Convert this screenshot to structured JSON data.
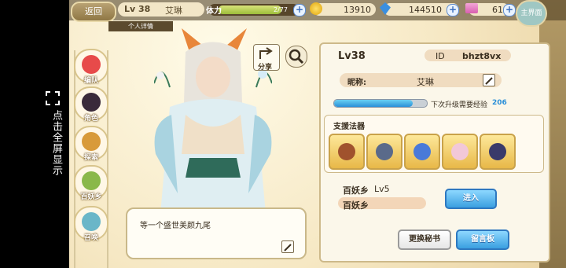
{
  "overlay": {
    "fullscreen_text": "点击全屏显示",
    "fullscreen_icon": "expand-icon"
  },
  "topbar": {
    "back_label": "返回",
    "level": "Lv 38",
    "player_name": "艾琳",
    "stamina_label": "体力",
    "stamina_value": "2/77",
    "gold": "13910",
    "gems": "144510",
    "tickets": "61",
    "main_label": "主界面",
    "tab_label": "个人详情"
  },
  "sidebar": {
    "items": [
      {
        "label": "编队",
        "icon": "team-icon"
      },
      {
        "label": "角色",
        "icon": "character-icon"
      },
      {
        "label": "探索",
        "icon": "explore-icon"
      },
      {
        "label": "百妖乡",
        "icon": "village-icon"
      },
      {
        "label": "召唤",
        "icon": "summon-icon"
      }
    ]
  },
  "stage": {
    "share_label": "分享",
    "quote": "等一个盛世美颜九尾"
  },
  "profile": {
    "level": "Lv38",
    "id_label": "ID",
    "id_value": "bhzt8vx",
    "nickname_label": "昵称:",
    "nickname_value": "艾琳",
    "xp_label": "下次升级需要经验",
    "xp_value": "206",
    "xp_progress": 0.85,
    "support_title": "支援法器",
    "support_items": [
      {
        "icon": "crossbow-icon"
      },
      {
        "icon": "spear-icon"
      },
      {
        "icon": "gem-cluster-icon"
      },
      {
        "icon": "orb-icon"
      },
      {
        "icon": "ring-icon"
      }
    ],
    "village_label": "百妖乡",
    "village_level": "Lv5",
    "village_name": "百妖乡",
    "enter_label": "进入",
    "change_secretary_label": "更换秘书",
    "message_board_label": "留言板"
  },
  "colors": {
    "accent_blue": "#3a9fe0",
    "panel_bg": "#fbf7ea",
    "frame": "#cdb98a"
  }
}
